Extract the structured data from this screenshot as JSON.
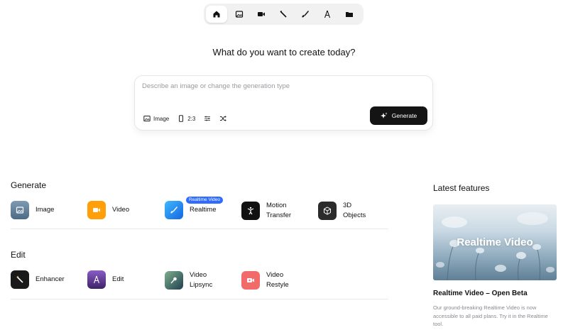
{
  "nav": {
    "items": [
      {
        "name": "home",
        "icon": "home-icon",
        "active": true
      },
      {
        "name": "image",
        "icon": "image-icon",
        "active": false
      },
      {
        "name": "video",
        "icon": "video-camera-icon",
        "active": false
      },
      {
        "name": "enhancer",
        "icon": "magic-wand-icon",
        "active": false
      },
      {
        "name": "realtime",
        "icon": "brush-icon",
        "active": false
      },
      {
        "name": "edit",
        "icon": "compass-icon",
        "active": false
      },
      {
        "name": "assets",
        "icon": "folder-icon",
        "active": false
      }
    ]
  },
  "headline": "What do you want to create today?",
  "prompt": {
    "placeholder": "Describe an image or change the generation type",
    "type_label": "Image",
    "aspect_label": "2:3",
    "generate_label": "Generate"
  },
  "generate": {
    "title": "Generate",
    "items": [
      {
        "label": "Image",
        "icon": "image-icon",
        "color": "#5d7d99"
      },
      {
        "label": "Video",
        "icon": "video-camera-icon",
        "color": "#ff9f0a"
      },
      {
        "label": "Realtime",
        "icon": "brush-icon",
        "color": "#1f8cf0",
        "badge": "Realtime Video"
      },
      {
        "label": "Motion Transfer",
        "icon": "person-icon",
        "color": "#111111"
      },
      {
        "label": "3D Objects",
        "icon": "cube-icon",
        "color": "#2b2b2b"
      }
    ]
  },
  "edit": {
    "title": "Edit",
    "items": [
      {
        "label": "Enhancer",
        "icon": "magic-wand-icon",
        "color": "#1a1a1a"
      },
      {
        "label": "Edit",
        "icon": "compass-icon",
        "color": "#6b3fa0"
      },
      {
        "label": "Video Lipsync",
        "icon": "microphone-icon",
        "color": "#3f6b5a"
      },
      {
        "label": "Video Restyle",
        "icon": "video-restyle-icon",
        "color": "#f26b6b"
      }
    ]
  },
  "latest": {
    "title": "Latest features",
    "image_text": "Realtime Video",
    "feature_title": "Realtime Video – Open Beta",
    "feature_desc": "Our ground-breaking Realtime Video is now accessible to all paid plans. Try it in the Realtime tool."
  }
}
